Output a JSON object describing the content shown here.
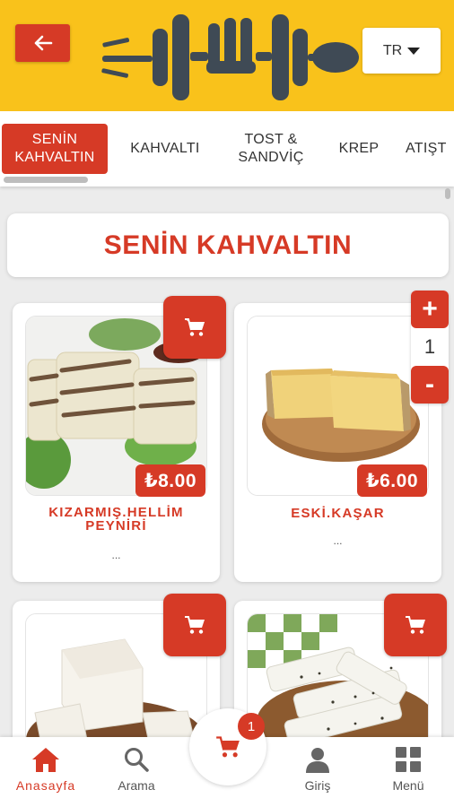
{
  "header": {
    "back_icon": "arrow-left-icon",
    "logo_icon": "fork-dumbbell-spoon-logo",
    "language": "TR"
  },
  "tabs": [
    {
      "label": "SENİN KAHVALTIN",
      "active": true
    },
    {
      "label": "KAHVALTI",
      "active": false
    },
    {
      "label": "TOST & SANDVİÇ",
      "active": false
    },
    {
      "label": "KREP",
      "active": false
    },
    {
      "label": "ATIŞT",
      "active": false
    }
  ],
  "section": {
    "title": "SENİN KAHVALTIN"
  },
  "products": [
    {
      "name": "KIZARMIŞ.HELLİM PEYNİRİ",
      "price": "₺8.00",
      "desc": "..."
    },
    {
      "name": "ESKİ.KAŞAR",
      "price": "₺6.00",
      "desc": "...",
      "qty": "1"
    },
    {
      "name": "",
      "price": "",
      "desc": ""
    },
    {
      "name": "",
      "price": "",
      "desc": ""
    }
  ],
  "stepper": {
    "plus": "+",
    "minus": "-",
    "value": "1"
  },
  "bottom_nav": {
    "home": "Anasayfa",
    "search": "Arama",
    "login": "Giriş",
    "menu": "Menü",
    "cart_count": "1"
  },
  "colors": {
    "brand_red": "#d63a26",
    "header_yellow": "#f9c21b"
  }
}
